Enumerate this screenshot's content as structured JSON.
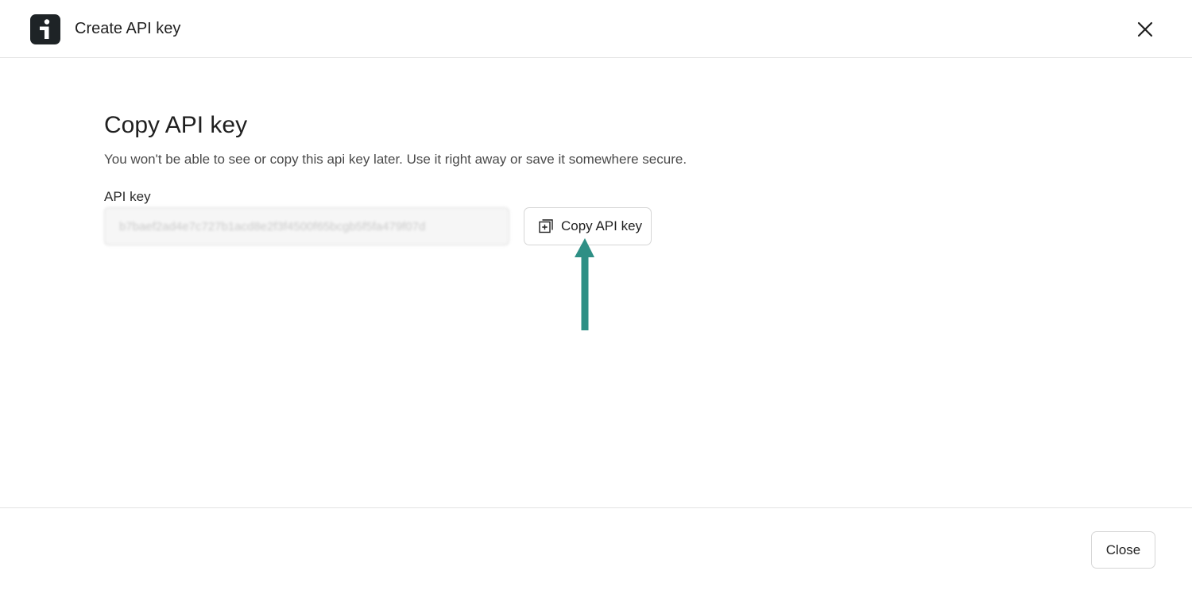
{
  "header": {
    "title": "Create API key",
    "logo_icon": "brand-logo-icon",
    "close_icon": "close-icon"
  },
  "main": {
    "title": "Copy API key",
    "description": "You won't be able to see or copy this api key later. Use it right away or save it somewhere secure.",
    "api_key_label": "API key",
    "api_key_value": "b7baef2ad4e7c727b1acd8e2f3f4500f65bcgb5f5fa479f07d",
    "copy_button_label": "Copy API key",
    "copy_button_icon": "copy-icon"
  },
  "annotation": {
    "arrow_icon": "up-arrow-icon",
    "arrow_color": "#2e8f85"
  },
  "footer": {
    "close_button_label": "Close"
  }
}
